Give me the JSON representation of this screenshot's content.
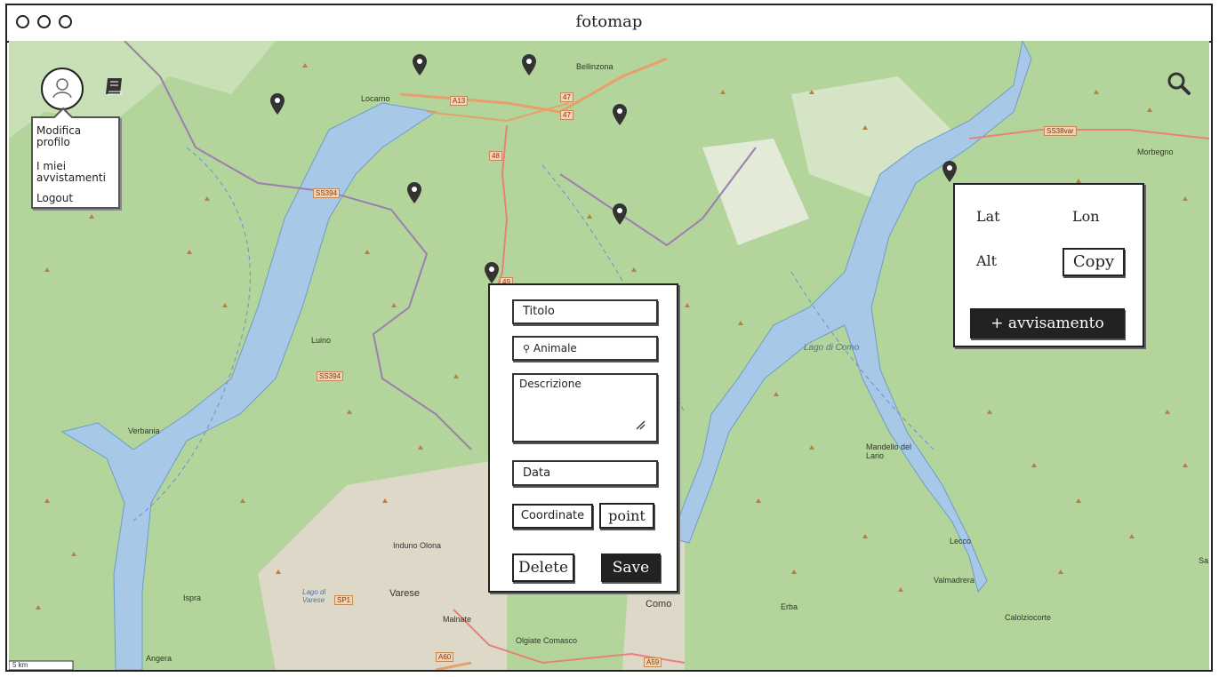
{
  "window": {
    "title": "fotomap"
  },
  "user_menu": {
    "items": [
      {
        "label": "Modifica profilo"
      },
      {
        "label": "I miei avvistamenti"
      },
      {
        "label": "Logout"
      }
    ]
  },
  "map": {
    "places": [
      "Bellinzona",
      "Locarno",
      "Morbegno",
      "Luino",
      "Verbania",
      "Mandello del Lario",
      "Induno Olona",
      "Varese",
      "Malnate",
      "Ispra",
      "Lecco",
      "Valmadrera",
      "Erba",
      "Como",
      "Calolziocorte",
      "Olgiate Comasco",
      "Angera",
      "Sa"
    ],
    "roads": [
      "A13",
      "SS394",
      "SS394",
      "47",
      "47",
      "48",
      "49",
      "SS38var",
      "SP1",
      "A60",
      "A59"
    ],
    "lakes": [
      "Lago di Como",
      "Lago di Varese"
    ],
    "scale": "5 km"
  },
  "form": {
    "title_placeholder": "Titolo",
    "animal_placeholder": "Animale",
    "description_placeholder": "Descrizione",
    "date_placeholder": "Data",
    "coordinate_label": "Coordinate",
    "point_label": "point",
    "delete_label": "Delete",
    "save_label": "Save"
  },
  "coords_panel": {
    "lat_label": "Lat",
    "lon_label": "Lon",
    "alt_label": "Alt",
    "copy_label": "Copy",
    "add_label": "+ avvisamento"
  },
  "colors": {
    "map_green": "#a9cf94",
    "lake_blue": "#a8c8e8",
    "border_purple": "#9b7fb0",
    "dark_button": "#222222"
  },
  "icons": {
    "avatar": "user-icon",
    "book": "book-icon",
    "search": "search-icon",
    "pin": "map-pin-icon"
  }
}
